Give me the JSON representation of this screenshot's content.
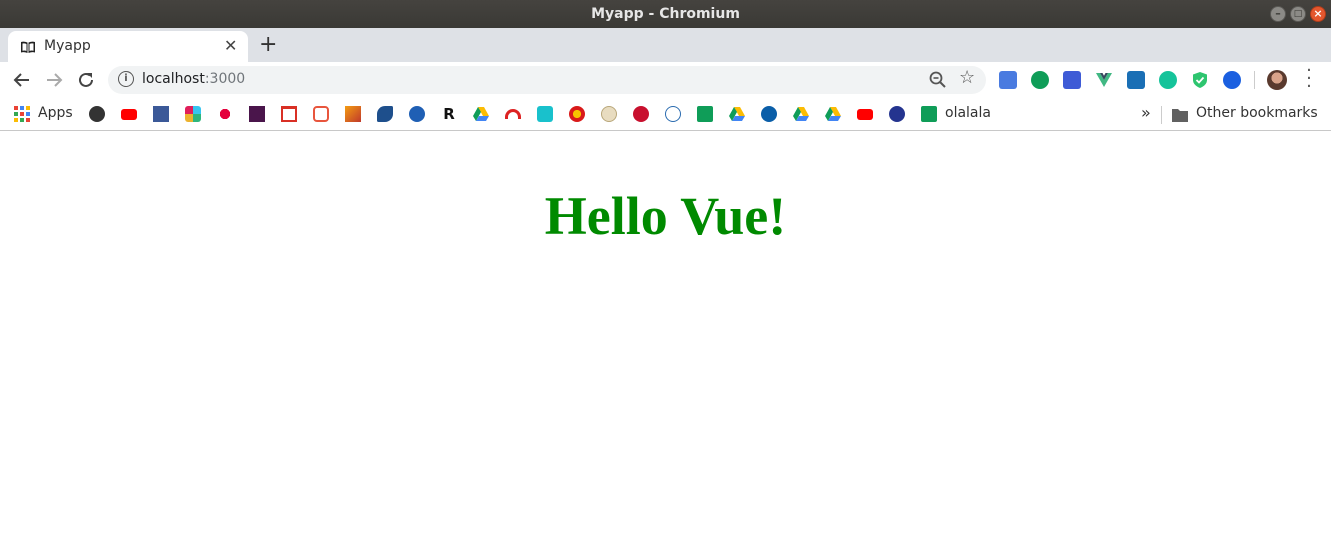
{
  "window": {
    "title": "Myapp - Chromium",
    "controls": {
      "minimize": "–",
      "maximize": "□",
      "close": "×"
    }
  },
  "tabs": [
    {
      "label": "Myapp",
      "icon": "book-icon",
      "close": "✕"
    }
  ],
  "new_tab": "+",
  "address_bar": {
    "host": "localhost",
    "port": ":3000",
    "info_icon": "i",
    "star": "☆"
  },
  "extensions": [
    "google-translate-icon",
    "hangouts-icon",
    "extension-wallet-icon",
    "vue-devtools-icon",
    "screenshot-icon",
    "grammarly-icon",
    "shield-icon",
    "bookmark-ext-icon"
  ],
  "bookmarks": {
    "apps_label": "Apps",
    "olalala_label": "olalala",
    "other_bookmarks_label": "Other bookmarks",
    "overflow": "»"
  },
  "page": {
    "heading": "Hello Vue!",
    "heading_color": "#008a00"
  },
  "colors": {
    "titlebar": "#3d3c38",
    "tabstrip": "#dee1e6",
    "omnibox": "#f1f3f4",
    "close_button": "#e4572e"
  }
}
